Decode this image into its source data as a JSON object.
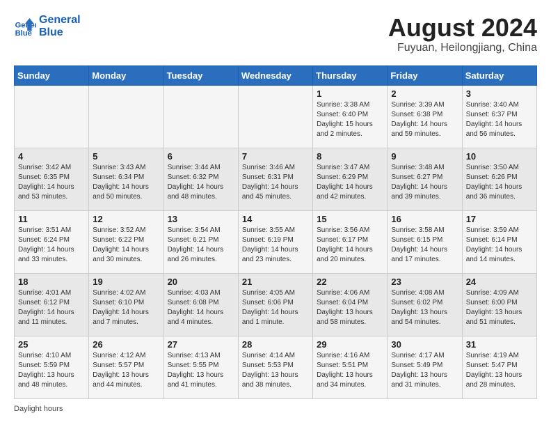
{
  "header": {
    "logo_line1": "General",
    "logo_line2": "Blue",
    "month_year": "August 2024",
    "location": "Fuyuan, Heilongjiang, China"
  },
  "days_of_week": [
    "Sunday",
    "Monday",
    "Tuesday",
    "Wednesday",
    "Thursday",
    "Friday",
    "Saturday"
  ],
  "note": "Daylight hours",
  "weeks": [
    [
      {
        "day": "",
        "info": ""
      },
      {
        "day": "",
        "info": ""
      },
      {
        "day": "",
        "info": ""
      },
      {
        "day": "",
        "info": ""
      },
      {
        "day": "1",
        "info": "Sunrise: 3:38 AM\nSunset: 6:40 PM\nDaylight: 15 hours\nand 2 minutes."
      },
      {
        "day": "2",
        "info": "Sunrise: 3:39 AM\nSunset: 6:38 PM\nDaylight: 14 hours\nand 59 minutes."
      },
      {
        "day": "3",
        "info": "Sunrise: 3:40 AM\nSunset: 6:37 PM\nDaylight: 14 hours\nand 56 minutes."
      }
    ],
    [
      {
        "day": "4",
        "info": "Sunrise: 3:42 AM\nSunset: 6:35 PM\nDaylight: 14 hours\nand 53 minutes."
      },
      {
        "day": "5",
        "info": "Sunrise: 3:43 AM\nSunset: 6:34 PM\nDaylight: 14 hours\nand 50 minutes."
      },
      {
        "day": "6",
        "info": "Sunrise: 3:44 AM\nSunset: 6:32 PM\nDaylight: 14 hours\nand 48 minutes."
      },
      {
        "day": "7",
        "info": "Sunrise: 3:46 AM\nSunset: 6:31 PM\nDaylight: 14 hours\nand 45 minutes."
      },
      {
        "day": "8",
        "info": "Sunrise: 3:47 AM\nSunset: 6:29 PM\nDaylight: 14 hours\nand 42 minutes."
      },
      {
        "day": "9",
        "info": "Sunrise: 3:48 AM\nSunset: 6:27 PM\nDaylight: 14 hours\nand 39 minutes."
      },
      {
        "day": "10",
        "info": "Sunrise: 3:50 AM\nSunset: 6:26 PM\nDaylight: 14 hours\nand 36 minutes."
      }
    ],
    [
      {
        "day": "11",
        "info": "Sunrise: 3:51 AM\nSunset: 6:24 PM\nDaylight: 14 hours\nand 33 minutes."
      },
      {
        "day": "12",
        "info": "Sunrise: 3:52 AM\nSunset: 6:22 PM\nDaylight: 14 hours\nand 30 minutes."
      },
      {
        "day": "13",
        "info": "Sunrise: 3:54 AM\nSunset: 6:21 PM\nDaylight: 14 hours\nand 26 minutes."
      },
      {
        "day": "14",
        "info": "Sunrise: 3:55 AM\nSunset: 6:19 PM\nDaylight: 14 hours\nand 23 minutes."
      },
      {
        "day": "15",
        "info": "Sunrise: 3:56 AM\nSunset: 6:17 PM\nDaylight: 14 hours\nand 20 minutes."
      },
      {
        "day": "16",
        "info": "Sunrise: 3:58 AM\nSunset: 6:15 PM\nDaylight: 14 hours\nand 17 minutes."
      },
      {
        "day": "17",
        "info": "Sunrise: 3:59 AM\nSunset: 6:14 PM\nDaylight: 14 hours\nand 14 minutes."
      }
    ],
    [
      {
        "day": "18",
        "info": "Sunrise: 4:01 AM\nSunset: 6:12 PM\nDaylight: 14 hours\nand 11 minutes."
      },
      {
        "day": "19",
        "info": "Sunrise: 4:02 AM\nSunset: 6:10 PM\nDaylight: 14 hours\nand 7 minutes."
      },
      {
        "day": "20",
        "info": "Sunrise: 4:03 AM\nSunset: 6:08 PM\nDaylight: 14 hours\nand 4 minutes."
      },
      {
        "day": "21",
        "info": "Sunrise: 4:05 AM\nSunset: 6:06 PM\nDaylight: 14 hours\nand 1 minute."
      },
      {
        "day": "22",
        "info": "Sunrise: 4:06 AM\nSunset: 6:04 PM\nDaylight: 13 hours\nand 58 minutes."
      },
      {
        "day": "23",
        "info": "Sunrise: 4:08 AM\nSunset: 6:02 PM\nDaylight: 13 hours\nand 54 minutes."
      },
      {
        "day": "24",
        "info": "Sunrise: 4:09 AM\nSunset: 6:00 PM\nDaylight: 13 hours\nand 51 minutes."
      }
    ],
    [
      {
        "day": "25",
        "info": "Sunrise: 4:10 AM\nSunset: 5:59 PM\nDaylight: 13 hours\nand 48 minutes."
      },
      {
        "day": "26",
        "info": "Sunrise: 4:12 AM\nSunset: 5:57 PM\nDaylight: 13 hours\nand 44 minutes."
      },
      {
        "day": "27",
        "info": "Sunrise: 4:13 AM\nSunset: 5:55 PM\nDaylight: 13 hours\nand 41 minutes."
      },
      {
        "day": "28",
        "info": "Sunrise: 4:14 AM\nSunset: 5:53 PM\nDaylight: 13 hours\nand 38 minutes."
      },
      {
        "day": "29",
        "info": "Sunrise: 4:16 AM\nSunset: 5:51 PM\nDaylight: 13 hours\nand 34 minutes."
      },
      {
        "day": "30",
        "info": "Sunrise: 4:17 AM\nSunset: 5:49 PM\nDaylight: 13 hours\nand 31 minutes."
      },
      {
        "day": "31",
        "info": "Sunrise: 4:19 AM\nSunset: 5:47 PM\nDaylight: 13 hours\nand 28 minutes."
      }
    ]
  ]
}
